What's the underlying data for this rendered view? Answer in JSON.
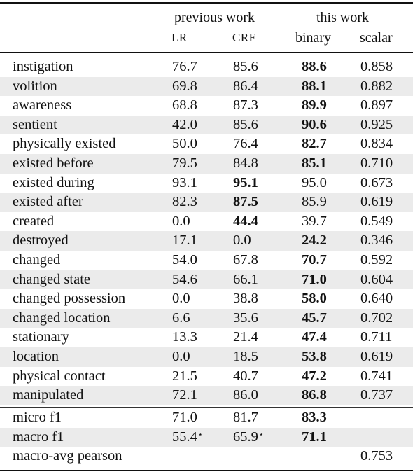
{
  "header": {
    "group_previous": "previous work",
    "group_this": "this work",
    "col_lr": "LR",
    "col_crf": "CRF",
    "col_binary": "binary",
    "col_scalar": "scalar"
  },
  "rows": [
    {
      "label": "instigation",
      "lr": "76.7",
      "crf": "85.6",
      "binary": "88.6",
      "scalar": "0.858",
      "bold": "binary",
      "shade": false
    },
    {
      "label": "volition",
      "lr": "69.8",
      "crf": "86.4",
      "binary": "88.1",
      "scalar": "0.882",
      "bold": "binary",
      "shade": true
    },
    {
      "label": "awareness",
      "lr": "68.8",
      "crf": "87.3",
      "binary": "89.9",
      "scalar": "0.897",
      "bold": "binary",
      "shade": false
    },
    {
      "label": "sentient",
      "lr": "42.0",
      "crf": "85.6",
      "binary": "90.6",
      "scalar": "0.925",
      "bold": "binary",
      "shade": true
    },
    {
      "label": "physically existed",
      "lr": "50.0",
      "crf": "76.4",
      "binary": "82.7",
      "scalar": "0.834",
      "bold": "binary",
      "shade": false
    },
    {
      "label": "existed before",
      "lr": "79.5",
      "crf": "84.8",
      "binary": "85.1",
      "scalar": "0.710",
      "bold": "binary",
      "shade": true
    },
    {
      "label": "existed during",
      "lr": "93.1",
      "crf": "95.1",
      "binary": "95.0",
      "scalar": "0.673",
      "bold": "crf",
      "shade": false
    },
    {
      "label": "existed after",
      "lr": "82.3",
      "crf": "87.5",
      "binary": "85.9",
      "scalar": "0.619",
      "bold": "crf",
      "shade": true
    },
    {
      "label": "created",
      "lr": "0.0",
      "crf": "44.4",
      "binary": "39.7",
      "scalar": "0.549",
      "bold": "crf",
      "shade": false
    },
    {
      "label": "destroyed",
      "lr": "17.1",
      "crf": "0.0",
      "binary": "24.2",
      "scalar": "0.346",
      "bold": "binary",
      "shade": true
    },
    {
      "label": "changed",
      "lr": "54.0",
      "crf": "67.8",
      "binary": "70.7",
      "scalar": "0.592",
      "bold": "binary",
      "shade": false
    },
    {
      "label": "changed state",
      "lr": "54.6",
      "crf": "66.1",
      "binary": "71.0",
      "scalar": "0.604",
      "bold": "binary",
      "shade": true
    },
    {
      "label": "changed possession",
      "lr": "0.0",
      "crf": "38.8",
      "binary": "58.0",
      "scalar": "0.640",
      "bold": "binary",
      "shade": false
    },
    {
      "label": "changed location",
      "lr": "6.6",
      "crf": "35.6",
      "binary": "45.7",
      "scalar": "0.702",
      "bold": "binary",
      "shade": true
    },
    {
      "label": "stationary",
      "lr": "13.3",
      "crf": "21.4",
      "binary": "47.4",
      "scalar": "0.711",
      "bold": "binary",
      "shade": false
    },
    {
      "label": "location",
      "lr": "0.0",
      "crf": "18.5",
      "binary": "53.8",
      "scalar": "0.619",
      "bold": "binary",
      "shade": true
    },
    {
      "label": "physical contact",
      "lr": "21.5",
      "crf": "40.7",
      "binary": "47.2",
      "scalar": "0.741",
      "bold": "binary",
      "shade": false
    },
    {
      "label": "manipulated",
      "lr": "72.1",
      "crf": "86.0",
      "binary": "86.8",
      "scalar": "0.737",
      "bold": "binary",
      "shade": true
    }
  ],
  "summary": [
    {
      "label": "micro f1",
      "lr": "71.0",
      "crf": "81.7",
      "binary": "83.3",
      "scalar": "",
      "bold": "binary",
      "shade": false,
      "star": false
    },
    {
      "label": "macro f1",
      "lr": "55.4",
      "crf": "65.9",
      "binary": "71.1",
      "scalar": "",
      "bold": "binary",
      "shade": true,
      "star": true
    },
    {
      "label": "macro-avg pearson",
      "lr": "",
      "crf": "",
      "binary": "",
      "scalar": "0.753",
      "bold": "",
      "shade": false,
      "star": false
    }
  ],
  "star_symbol": "⋆"
}
